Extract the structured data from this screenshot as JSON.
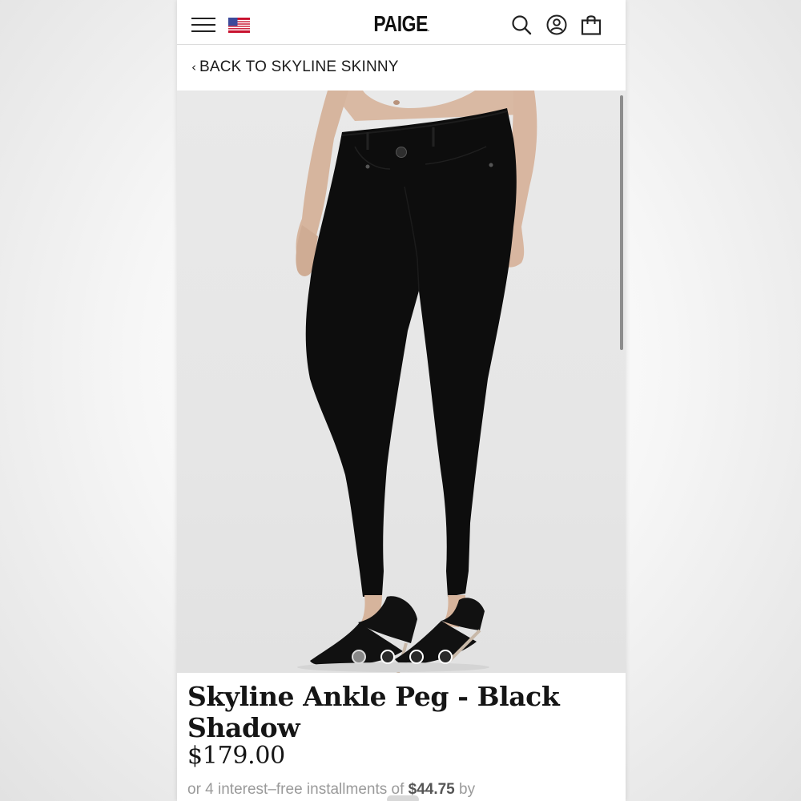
{
  "header": {
    "logo": "PAIGE",
    "logo_mark": ".",
    "icons": [
      "hamburger-menu-icon",
      "us-flag-icon",
      "search-icon",
      "account-icon",
      "shopping-bag-icon"
    ]
  },
  "nav": {
    "back_label": "BACK TO SKYLINE SKINNY",
    "back_icon": "chevron-left-icon"
  },
  "product": {
    "image_alt": "",
    "title": "Skyline Ankle Peg - Black Shadow",
    "price": "$179.00",
    "installment_prefix": "or 4 interest–free installments of",
    "installment_amount": "$44.75",
    "installment_suffix": "by"
  },
  "gallery": {
    "slide_count": 4,
    "active_index": 0
  },
  "colors": {
    "text": "#151515",
    "image_background": "#e7e7e7",
    "product_black": "#0c0c0c"
  }
}
